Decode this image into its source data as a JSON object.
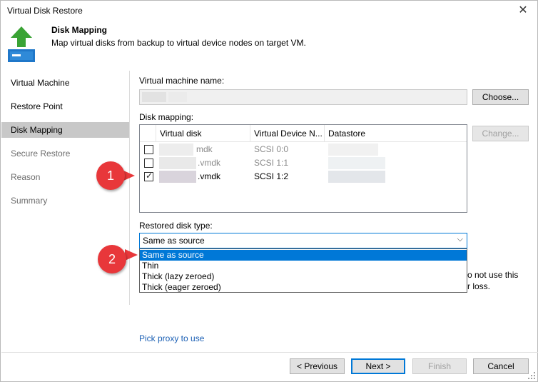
{
  "window": {
    "title": "Virtual Disk Restore",
    "close_glyph": "✕"
  },
  "header": {
    "title": "Disk Mapping",
    "subtitle": "Map virtual disks from backup to virtual device nodes on target VM.",
    "icon": "restore-arrow-icon"
  },
  "sidebar": {
    "items": [
      {
        "label": "Virtual Machine",
        "state": "normal"
      },
      {
        "label": "Restore Point",
        "state": "normal"
      },
      {
        "label": "Disk Mapping",
        "state": "active"
      },
      {
        "label": "Secure Restore",
        "state": "disabled"
      },
      {
        "label": "Reason",
        "state": "disabled"
      },
      {
        "label": "Summary",
        "state": "disabled"
      }
    ]
  },
  "main": {
    "vm_name_label": "Virtual machine name:",
    "choose_button": "Choose...",
    "disk_mapping_label": "Disk mapping:",
    "change_button": "Change...",
    "columns": [
      "Virtual disk",
      "Virtual Device N...",
      "Datastore"
    ],
    "rows": [
      {
        "checked": false,
        "disk": "mdk",
        "node": "SCSI 0:0"
      },
      {
        "checked": false,
        "disk": ".vmdk",
        "node": "SCSI 1:1"
      },
      {
        "checked": true,
        "disk": ".vmdk",
        "node": "SCSI 1:2"
      }
    ],
    "check_glyph": "✓",
    "restored_type_label": "Restored disk type:",
    "restored_type_value": "Same as source",
    "dropdown_arrow": "⌵",
    "options": [
      "Same as source",
      "Thin",
      "Thick (lazy zeroed)",
      "Thick (eager zeroed)"
    ],
    "hidden_text_1": "o not use this",
    "hidden_text_2": "r loss.",
    "pick_proxy_link": "Pick proxy to use"
  },
  "footer": {
    "previous": "< Previous",
    "next": "Next >",
    "finish": "Finish",
    "cancel": "Cancel"
  },
  "callouts": [
    "1",
    "2"
  ],
  "colors": {
    "accent": "#0078d7",
    "callout": "#e8373a",
    "header_arrow": "#3aa335"
  }
}
